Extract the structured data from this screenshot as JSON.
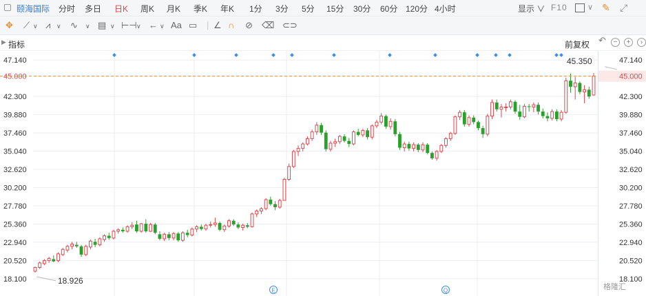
{
  "header": {
    "stock_name": "颐海国际",
    "tabs": [
      "分时",
      "多日",
      "日K",
      "周K",
      "月K",
      "季K",
      "年K",
      "1分",
      "3分",
      "5分",
      "15分",
      "30分",
      "60分",
      "120分",
      "4小时"
    ],
    "selected_tab": "日K",
    "display_label": "显示",
    "f10_label": "F10"
  },
  "toolbar": {
    "text_tool": "Aa"
  },
  "indicator_row": {
    "label": "指标",
    "restore_label": "前复权"
  },
  "watermark": "格隆汇",
  "colors": {
    "up": "#e0474c",
    "down": "#2ca02c",
    "price_line": "#f08a24",
    "event_marker": "#3a8ee6",
    "grid": "#eceef2",
    "right_axis_highlight": "#e0474c"
  },
  "chart_data": {
    "type": "candlestick",
    "ylim": [
      16.9,
      48.35
    ],
    "ytick_labels": [
      "47.140",
      "45.000",
      "42.300",
      "39.880",
      "37.460",
      "35.040",
      "32.620",
      "30.200",
      "27.780",
      "25.360",
      "22.940",
      "20.520",
      "18.100"
    ],
    "yticks": [
      47.14,
      45.0,
      42.3,
      39.88,
      37.46,
      35.04,
      32.62,
      30.2,
      27.78,
      25.36,
      22.94,
      20.52,
      18.1
    ],
    "current_price_label": "45.000",
    "current_price": 45.0,
    "high_annotation": {
      "label": "45.350",
      "value": 45.35
    },
    "low_annotation": {
      "label": "18.926",
      "value": 18.926
    },
    "event_markers": [
      "E",
      "Q"
    ],
    "candles": [
      {
        "o": 19.1,
        "h": 19.7,
        "l": 18.9,
        "c": 19.6
      },
      {
        "o": 19.6,
        "h": 20.4,
        "l": 19.4,
        "c": 20.2
      },
      {
        "o": 20.1,
        "h": 20.7,
        "l": 19.9,
        "c": 20.5
      },
      {
        "o": 20.5,
        "h": 21.0,
        "l": 20.2,
        "c": 20.8
      },
      {
        "o": 20.7,
        "h": 21.2,
        "l": 20.3,
        "c": 20.4
      },
      {
        "o": 20.5,
        "h": 21.6,
        "l": 20.3,
        "c": 21.4
      },
      {
        "o": 21.3,
        "h": 22.2,
        "l": 21.1,
        "c": 22.0
      },
      {
        "o": 21.9,
        "h": 22.6,
        "l": 21.6,
        "c": 22.4
      },
      {
        "o": 22.4,
        "h": 23.0,
        "l": 22.0,
        "c": 22.7
      },
      {
        "o": 22.6,
        "h": 23.0,
        "l": 22.2,
        "c": 22.4
      },
      {
        "o": 22.4,
        "h": 22.6,
        "l": 21.0,
        "c": 21.3
      },
      {
        "o": 21.3,
        "h": 22.6,
        "l": 21.1,
        "c": 22.4
      },
      {
        "o": 22.3,
        "h": 23.3,
        "l": 22.0,
        "c": 23.1
      },
      {
        "o": 23.0,
        "h": 23.4,
        "l": 22.3,
        "c": 22.6
      },
      {
        "o": 22.6,
        "h": 23.6,
        "l": 22.4,
        "c": 23.4
      },
      {
        "o": 23.3,
        "h": 24.0,
        "l": 23.0,
        "c": 23.8
      },
      {
        "o": 23.8,
        "h": 24.2,
        "l": 23.3,
        "c": 23.5
      },
      {
        "o": 23.5,
        "h": 24.6,
        "l": 23.3,
        "c": 24.4
      },
      {
        "o": 24.4,
        "h": 24.8,
        "l": 24.1,
        "c": 24.6
      },
      {
        "o": 24.6,
        "h": 24.9,
        "l": 24.2,
        "c": 24.4
      },
      {
        "o": 24.4,
        "h": 25.2,
        "l": 24.2,
        "c": 25.0
      },
      {
        "o": 25.0,
        "h": 25.6,
        "l": 24.7,
        "c": 25.2
      },
      {
        "o": 25.3,
        "h": 25.8,
        "l": 24.2,
        "c": 24.4
      },
      {
        "o": 24.4,
        "h": 25.5,
        "l": 24.2,
        "c": 25.4
      },
      {
        "o": 25.4,
        "h": 26.0,
        "l": 24.2,
        "c": 24.4
      },
      {
        "o": 24.4,
        "h": 25.5,
        "l": 24.3,
        "c": 25.3
      },
      {
        "o": 25.3,
        "h": 25.5,
        "l": 24.0,
        "c": 24.2
      },
      {
        "o": 24.0,
        "h": 24.4,
        "l": 23.2,
        "c": 23.4
      },
      {
        "o": 23.4,
        "h": 24.2,
        "l": 23.1,
        "c": 24.0
      },
      {
        "o": 24.0,
        "h": 24.3,
        "l": 23.2,
        "c": 23.5
      },
      {
        "o": 23.5,
        "h": 24.3,
        "l": 23.2,
        "c": 24.1
      },
      {
        "o": 24.1,
        "h": 24.3,
        "l": 23.0,
        "c": 23.2
      },
      {
        "o": 23.2,
        "h": 24.4,
        "l": 23.0,
        "c": 24.2
      },
      {
        "o": 24.2,
        "h": 24.6,
        "l": 23.6,
        "c": 23.9
      },
      {
        "o": 23.9,
        "h": 24.9,
        "l": 23.7,
        "c": 24.7
      },
      {
        "o": 24.7,
        "h": 25.2,
        "l": 24.3,
        "c": 25.0
      },
      {
        "o": 25.0,
        "h": 25.3,
        "l": 24.5,
        "c": 24.7
      },
      {
        "o": 24.7,
        "h": 25.4,
        "l": 24.5,
        "c": 25.2
      },
      {
        "o": 25.2,
        "h": 25.7,
        "l": 24.9,
        "c": 25.3
      },
      {
        "o": 25.3,
        "h": 26.2,
        "l": 25.0,
        "c": 25.5
      },
      {
        "o": 25.5,
        "h": 25.7,
        "l": 24.4,
        "c": 24.6
      },
      {
        "o": 24.6,
        "h": 25.3,
        "l": 24.3,
        "c": 25.1
      },
      {
        "o": 25.1,
        "h": 26.0,
        "l": 24.9,
        "c": 25.8
      },
      {
        "o": 25.8,
        "h": 26.0,
        "l": 25.1,
        "c": 25.3
      },
      {
        "o": 25.3,
        "h": 25.6,
        "l": 24.7,
        "c": 24.9
      },
      {
        "o": 24.9,
        "h": 25.4,
        "l": 24.5,
        "c": 25.2
      },
      {
        "o": 25.2,
        "h": 25.5,
        "l": 24.8,
        "c": 25.0
      },
      {
        "o": 25.0,
        "h": 26.9,
        "l": 24.9,
        "c": 26.7
      },
      {
        "o": 26.7,
        "h": 27.3,
        "l": 26.3,
        "c": 27.1
      },
      {
        "o": 27.1,
        "h": 27.6,
        "l": 26.7,
        "c": 27.4
      },
      {
        "o": 27.4,
        "h": 28.8,
        "l": 27.2,
        "c": 28.6
      },
      {
        "o": 28.6,
        "h": 29.0,
        "l": 27.8,
        "c": 28.0
      },
      {
        "o": 28.0,
        "h": 28.4,
        "l": 27.2,
        "c": 27.6
      },
      {
        "o": 27.6,
        "h": 28.7,
        "l": 27.4,
        "c": 28.5
      },
      {
        "o": 28.5,
        "h": 31.5,
        "l": 28.5,
        "c": 31.3
      },
      {
        "o": 31.3,
        "h": 33.4,
        "l": 31.1,
        "c": 33.0
      },
      {
        "o": 33.0,
        "h": 35.2,
        "l": 32.8,
        "c": 35.0
      },
      {
        "o": 35.0,
        "h": 35.8,
        "l": 34.4,
        "c": 35.4
      },
      {
        "o": 35.4,
        "h": 36.2,
        "l": 35.0,
        "c": 36.0
      },
      {
        "o": 36.0,
        "h": 37.0,
        "l": 35.8,
        "c": 36.7
      },
      {
        "o": 36.7,
        "h": 37.9,
        "l": 36.4,
        "c": 37.6
      },
      {
        "o": 37.6,
        "h": 38.9,
        "l": 37.2,
        "c": 38.5
      },
      {
        "o": 38.5,
        "h": 38.8,
        "l": 37.2,
        "c": 37.5
      },
      {
        "o": 37.5,
        "h": 37.8,
        "l": 35.0,
        "c": 35.3
      },
      {
        "o": 35.3,
        "h": 36.4,
        "l": 35.0,
        "c": 36.1
      },
      {
        "o": 36.1,
        "h": 36.7,
        "l": 35.6,
        "c": 36.3
      },
      {
        "o": 36.3,
        "h": 37.2,
        "l": 36.0,
        "c": 37.0
      },
      {
        "o": 37.0,
        "h": 37.3,
        "l": 36.2,
        "c": 36.4
      },
      {
        "o": 36.4,
        "h": 36.8,
        "l": 35.6,
        "c": 36.0
      },
      {
        "o": 36.0,
        "h": 37.8,
        "l": 35.8,
        "c": 37.6
      },
      {
        "o": 37.6,
        "h": 38.0,
        "l": 37.0,
        "c": 37.2
      },
      {
        "o": 37.2,
        "h": 38.0,
        "l": 36.9,
        "c": 37.8
      },
      {
        "o": 37.8,
        "h": 38.1,
        "l": 36.6,
        "c": 36.9
      },
      {
        "o": 36.9,
        "h": 38.6,
        "l": 36.6,
        "c": 38.4
      },
      {
        "o": 38.4,
        "h": 39.2,
        "l": 38.1,
        "c": 38.9
      },
      {
        "o": 38.9,
        "h": 40.1,
        "l": 38.6,
        "c": 39.7
      },
      {
        "o": 39.7,
        "h": 39.9,
        "l": 38.0,
        "c": 38.3
      },
      {
        "o": 38.3,
        "h": 39.4,
        "l": 37.9,
        "c": 39.0
      },
      {
        "o": 39.0,
        "h": 39.3,
        "l": 37.0,
        "c": 37.3
      },
      {
        "o": 37.3,
        "h": 37.6,
        "l": 35.2,
        "c": 35.5
      },
      {
        "o": 35.5,
        "h": 36.3,
        "l": 35.0,
        "c": 36.0
      },
      {
        "o": 36.0,
        "h": 36.3,
        "l": 35.1,
        "c": 35.4
      },
      {
        "o": 35.4,
        "h": 36.2,
        "l": 35.0,
        "c": 35.9
      },
      {
        "o": 35.9,
        "h": 36.1,
        "l": 34.9,
        "c": 35.2
      },
      {
        "o": 35.2,
        "h": 36.2,
        "l": 34.9,
        "c": 35.9
      },
      {
        "o": 35.9,
        "h": 36.1,
        "l": 34.6,
        "c": 34.8
      },
      {
        "o": 34.8,
        "h": 35.0,
        "l": 33.9,
        "c": 34.1
      },
      {
        "o": 34.1,
        "h": 35.2,
        "l": 33.8,
        "c": 35.0
      },
      {
        "o": 35.0,
        "h": 36.0,
        "l": 34.8,
        "c": 35.8
      },
      {
        "o": 35.8,
        "h": 36.9,
        "l": 35.5,
        "c": 36.7
      },
      {
        "o": 36.7,
        "h": 37.6,
        "l": 36.4,
        "c": 37.4
      },
      {
        "o": 37.4,
        "h": 39.8,
        "l": 37.2,
        "c": 39.6
      },
      {
        "o": 39.6,
        "h": 40.5,
        "l": 39.2,
        "c": 40.2
      },
      {
        "o": 40.2,
        "h": 40.5,
        "l": 38.3,
        "c": 38.6
      },
      {
        "o": 38.6,
        "h": 39.8,
        "l": 38.3,
        "c": 39.5
      },
      {
        "o": 39.5,
        "h": 39.8,
        "l": 38.6,
        "c": 38.9
      },
      {
        "o": 38.9,
        "h": 39.1,
        "l": 37.8,
        "c": 38.1
      },
      {
        "o": 38.1,
        "h": 38.4,
        "l": 36.8,
        "c": 37.3
      },
      {
        "o": 37.3,
        "h": 40.0,
        "l": 37.0,
        "c": 39.7
      },
      {
        "o": 39.7,
        "h": 41.9,
        "l": 39.3,
        "c": 41.5
      },
      {
        "o": 41.5,
        "h": 41.9,
        "l": 40.3,
        "c": 40.6
      },
      {
        "o": 40.6,
        "h": 41.3,
        "l": 39.5,
        "c": 40.9
      },
      {
        "o": 40.9,
        "h": 41.4,
        "l": 40.3,
        "c": 40.9
      },
      {
        "o": 40.9,
        "h": 41.9,
        "l": 40.6,
        "c": 41.6
      },
      {
        "o": 41.6,
        "h": 41.8,
        "l": 40.0,
        "c": 40.3
      },
      {
        "o": 40.3,
        "h": 41.2,
        "l": 39.2,
        "c": 39.6
      },
      {
        "o": 39.6,
        "h": 41.3,
        "l": 39.4,
        "c": 41.0
      },
      {
        "o": 41.0,
        "h": 41.3,
        "l": 40.3,
        "c": 40.9
      },
      {
        "o": 40.9,
        "h": 41.5,
        "l": 40.2,
        "c": 41.2
      },
      {
        "o": 41.2,
        "h": 41.5,
        "l": 39.9,
        "c": 40.3
      },
      {
        "o": 40.3,
        "h": 40.7,
        "l": 39.4,
        "c": 39.7
      },
      {
        "o": 39.7,
        "h": 40.2,
        "l": 39.0,
        "c": 39.4
      },
      {
        "o": 39.4,
        "h": 40.6,
        "l": 39.1,
        "c": 40.3
      },
      {
        "o": 40.3,
        "h": 40.6,
        "l": 39.0,
        "c": 39.3
      },
      {
        "o": 39.3,
        "h": 40.5,
        "l": 39.0,
        "c": 40.2
      },
      {
        "o": 40.2,
        "h": 44.8,
        "l": 40.0,
        "c": 44.4
      },
      {
        "o": 44.4,
        "h": 45.35,
        "l": 42.8,
        "c": 43.6
      },
      {
        "o": 43.6,
        "h": 44.9,
        "l": 41.9,
        "c": 44.1
      },
      {
        "o": 44.1,
        "h": 44.3,
        "l": 42.6,
        "c": 42.9
      },
      {
        "o": 42.9,
        "h": 43.8,
        "l": 41.4,
        "c": 43.2
      },
      {
        "o": 43.2,
        "h": 43.6,
        "l": 42.0,
        "c": 42.3
      },
      {
        "o": 42.5,
        "h": 45.4,
        "l": 42.4,
        "c": 45.0
      }
    ]
  }
}
